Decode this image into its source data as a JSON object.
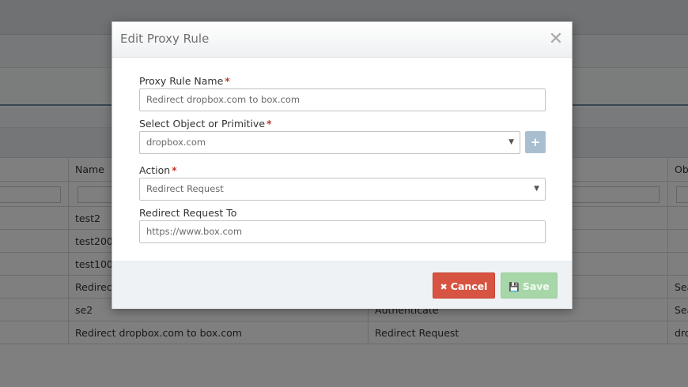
{
  "background": {
    "grid": {
      "headers": [
        "",
        "Name",
        "",
        "Obj"
      ],
      "rows": [
        [
          "",
          "test2",
          "",
          ""
        ],
        [
          "",
          "test200",
          "",
          ""
        ],
        [
          "",
          "test100",
          "",
          ""
        ],
        [
          "",
          "Redirect",
          "",
          "Sea"
        ],
        [
          "",
          "se2",
          "Authenticate",
          "Sea"
        ],
        [
          "",
          "Redirect dropbox.com to box.com",
          "Redirect Request",
          "dro"
        ]
      ]
    }
  },
  "modal": {
    "title": "Edit Proxy Rule",
    "close_glyph": "✕",
    "fields": {
      "rule_name": {
        "label": "Proxy Rule Name",
        "required_mark": "*",
        "value": "Redirect dropbox.com to box.com"
      },
      "object": {
        "label": "Select Object or Primitive",
        "required_mark": "*",
        "value": "dropbox.com"
      },
      "action": {
        "label": "Action",
        "required_mark": "*",
        "value": "Redirect Request"
      },
      "redirect_to": {
        "label": "Redirect Request To",
        "value": "https://www.box.com"
      }
    },
    "add_object_glyph": "+",
    "caret_glyph": "▼",
    "buttons": {
      "cancel_label": "Cancel",
      "cancel_icon": "✖",
      "save_label": "Save",
      "save_icon": "💾"
    },
    "colors": {
      "cancel": "#d75442",
      "save_disabled": "#a7d7a8",
      "required": "#c0392b",
      "add_button": "#a9bfd0"
    }
  }
}
